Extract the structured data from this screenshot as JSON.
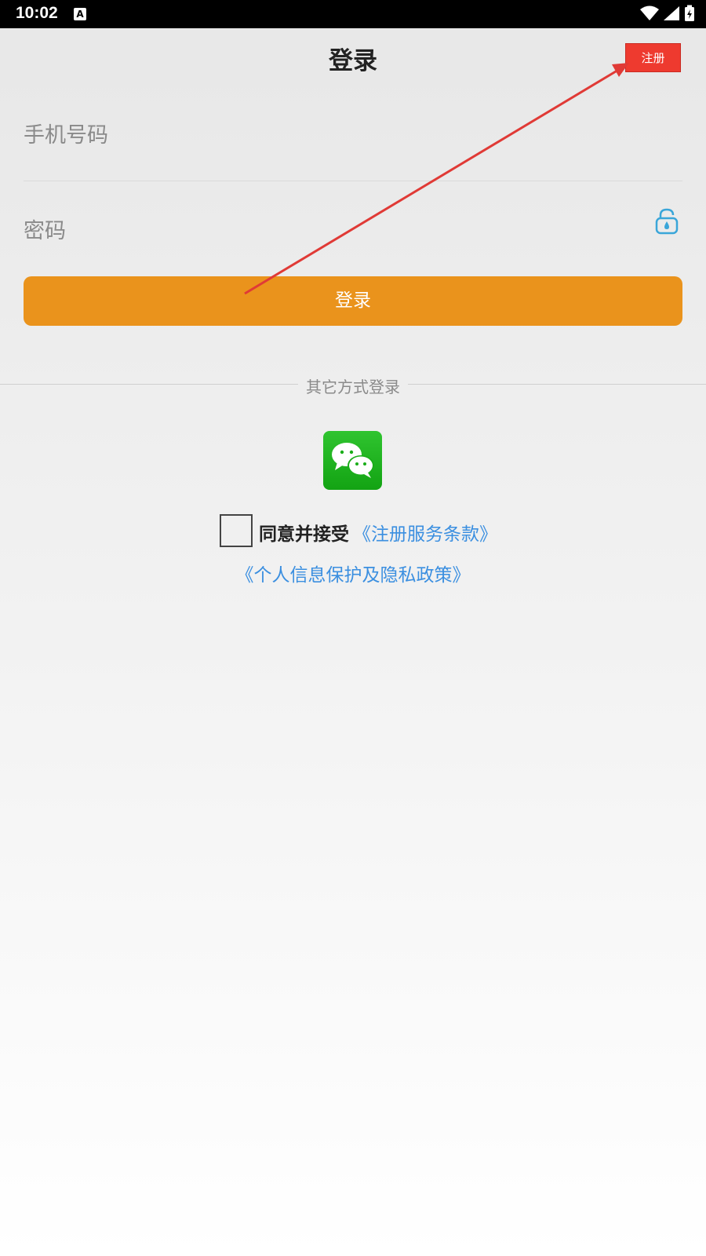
{
  "status_bar": {
    "time": "10:02",
    "notification_icon": "A"
  },
  "header": {
    "title": "登录",
    "register_label": "注册"
  },
  "form": {
    "phone_placeholder": "手机号码",
    "password_placeholder": "密码",
    "login_label": "登录"
  },
  "other_login": {
    "label": "其它方式登录",
    "wechat_icon": "wechat-icon"
  },
  "agreement": {
    "agree_text": "同意并接受",
    "terms_link": "《注册服务条款》",
    "privacy_link": "《个人信息保护及隐私政策》"
  },
  "colors": {
    "accent_orange": "#ea931c",
    "register_red": "#ee3a2f",
    "link_blue": "#3b8fe0",
    "wechat_green": "#1aad19"
  }
}
